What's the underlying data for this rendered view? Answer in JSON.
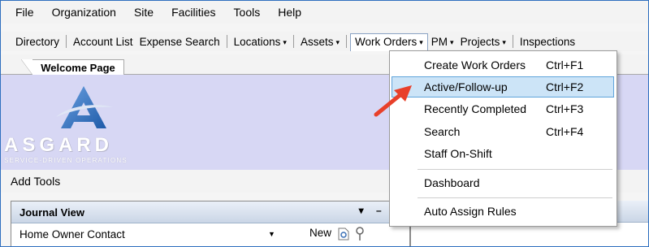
{
  "menubar": {
    "items": [
      "File",
      "Organization",
      "Site",
      "Facilities",
      "Tools",
      "Help"
    ]
  },
  "toolbar": {
    "items": [
      {
        "label": "Directory"
      },
      {
        "label": "Account List"
      },
      {
        "label": "Expense Search"
      },
      {
        "label": "Locations",
        "dropdown": true
      },
      {
        "label": "Assets",
        "dropdown": true
      },
      {
        "label": "Work Orders",
        "dropdown": true,
        "active": true
      },
      {
        "label": "PM",
        "dropdown": true
      },
      {
        "label": "Projects",
        "dropdown": true
      },
      {
        "label": "Inspections"
      }
    ],
    "caret": "▾"
  },
  "tabs": {
    "welcome": "Welcome Page"
  },
  "banner": {
    "logo_word": "ASGARD",
    "logo_sub": "SERVICE-DRIVEN OPERATIONS"
  },
  "add_tools": "Add Tools",
  "journal": {
    "title": "Journal View",
    "controls": "▾ – ×",
    "selected": "Home Owner Contact",
    "new_label": "New"
  },
  "work_orders_menu": {
    "items": [
      {
        "label": "Create Work Orders",
        "shortcut": "Ctrl+F1"
      },
      {
        "label": "Active/Follow-up",
        "shortcut": "Ctrl+F2",
        "highlighted": true
      },
      {
        "label": "Recently Completed",
        "shortcut": "Ctrl+F3"
      },
      {
        "label": "Search",
        "shortcut": "Ctrl+F4"
      },
      {
        "label": "Staff On-Shift",
        "shortcut": ""
      },
      {
        "label": "Dashboard",
        "shortcut": ""
      },
      {
        "label": "Auto Assign Rules",
        "shortcut": ""
      }
    ]
  },
  "colors": {
    "banner": "#d7d7f4",
    "highlight": "#cce4f7",
    "arrow": "#e8402a",
    "logo_blue": "#1e5aa8"
  }
}
